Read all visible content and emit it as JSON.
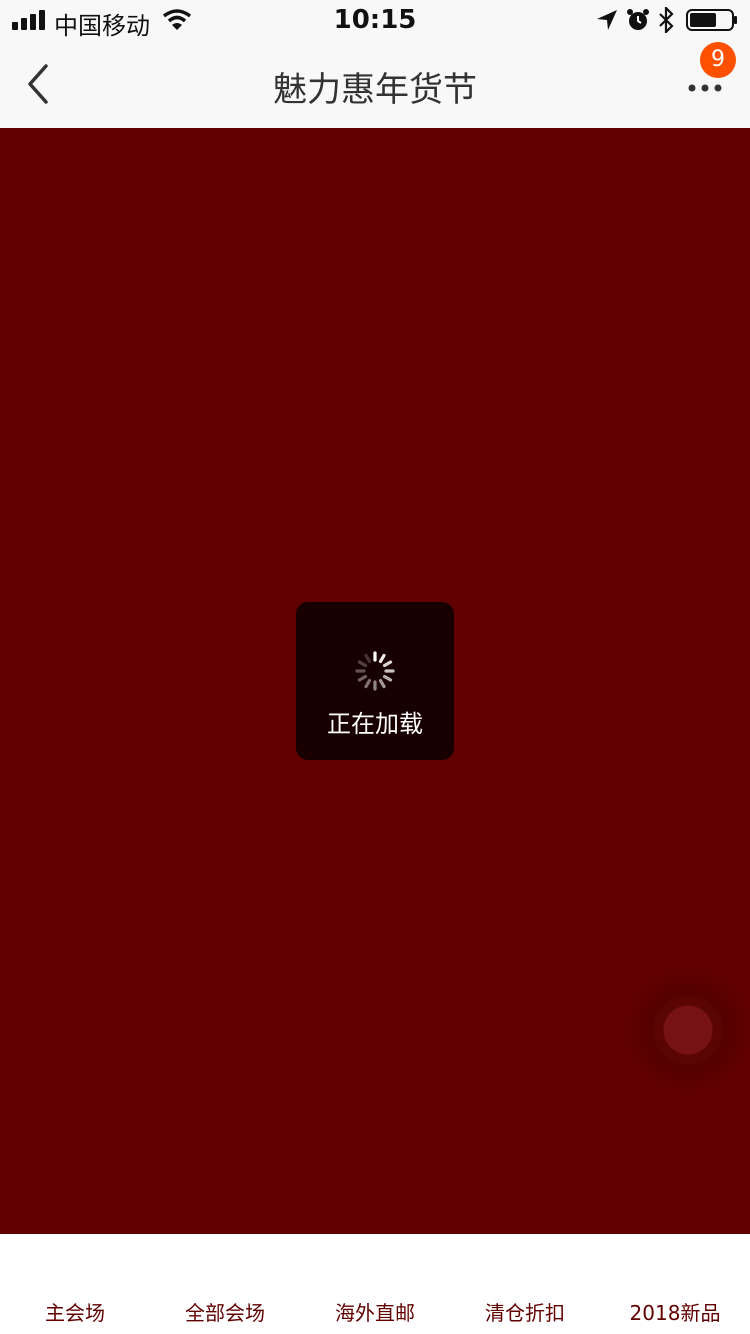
{
  "status_bar": {
    "carrier": "中国移动",
    "time": "10:15"
  },
  "nav": {
    "title": "魅力惠年货节",
    "badge_count": "9"
  },
  "loading": {
    "text": "正在加载"
  },
  "tabbar": {
    "items": [
      {
        "label": "主会场"
      },
      {
        "label": "全部会场"
      },
      {
        "label": "海外直邮"
      },
      {
        "label": "清仓折扣"
      },
      {
        "label": "2018新品"
      }
    ]
  },
  "colors": {
    "page_background": "#600000",
    "badge": "#ff5000",
    "tab_text": "#600000"
  },
  "icons": [
    "signal-icon",
    "wifi-icon",
    "location-icon",
    "alarm-icon",
    "bluetooth-icon",
    "battery-icon",
    "back-icon",
    "more-icon",
    "spinner-icon"
  ]
}
